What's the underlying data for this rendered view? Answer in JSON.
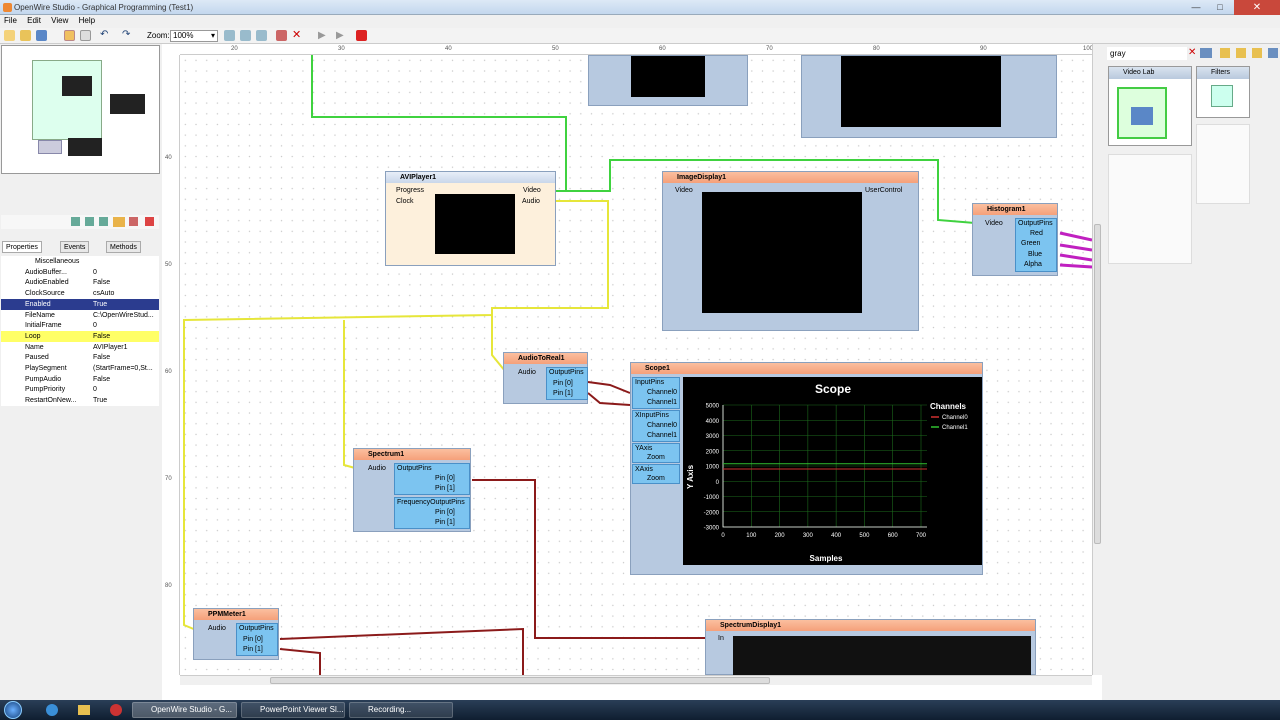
{
  "window": {
    "title": "OpenWire Studio - Graphical Programming (Test1)"
  },
  "menu": [
    "File",
    "Edit",
    "View",
    "Help"
  ],
  "toolbar": {
    "zoom_label": "Zoom:",
    "zoom_value": "100%"
  },
  "ruler": {
    "top": [
      "20",
      "30",
      "40",
      "50",
      "60",
      "70",
      "80",
      "90",
      "100"
    ],
    "left": [
      "40",
      "50",
      "60",
      "70",
      "80"
    ]
  },
  "properties": {
    "tabs": [
      "Properties",
      "Events",
      "Methods"
    ],
    "rows": [
      {
        "name": "Miscellaneous",
        "value": ""
      },
      {
        "name": "AudioBuffer...",
        "value": "0"
      },
      {
        "name": "AudioEnabled",
        "value": "False"
      },
      {
        "name": "ClockSource",
        "value": "csAuto"
      },
      {
        "name": "Enabled",
        "value": "True"
      },
      {
        "name": "FileName",
        "value": "C:\\OpenWireStud..."
      },
      {
        "name": "InitialFrame",
        "value": "0"
      },
      {
        "name": "Loop",
        "value": "False"
      },
      {
        "name": "Name",
        "value": "AVIPlayer1"
      },
      {
        "name": "Paused",
        "value": "False"
      },
      {
        "name": "PlaySegment",
        "value": "(StartFrame=0,St..."
      },
      {
        "name": "PumpAudio",
        "value": "False"
      },
      {
        "name": "PumpPriority",
        "value": "0"
      },
      {
        "name": "RestartOnNew...",
        "value": "True"
      }
    ]
  },
  "components": {
    "avi": {
      "title": "AVIPlayer1",
      "pins": [
        "Progress",
        "Clock",
        "Video",
        "Audio"
      ]
    },
    "imagedisplay": {
      "title": "ImageDisplay1",
      "pins": [
        "Video",
        "UserControl"
      ]
    },
    "histogram": {
      "title": "Histogram1",
      "pins": [
        "Video",
        "OutputPins",
        "Red",
        "Green",
        "Blue",
        "Alpha"
      ]
    },
    "audiotoreal": {
      "title": "AudioToReal1",
      "pins": [
        "Audio",
        "OutputPins",
        "Pin [0]",
        "Pin [1]"
      ]
    },
    "spectrum": {
      "title": "Spectrum1",
      "pins": [
        "Audio",
        "OutputPins",
        "Pin [0]",
        "Pin [1]",
        "FrequencyOutputPins",
        "Pin [0]",
        "Pin [1]"
      ]
    },
    "ppm": {
      "title": "PPMMeter1",
      "pins": [
        "Audio",
        "OutputPins",
        "Pin [0]",
        "Pin [1]"
      ]
    },
    "spectrumdisplay": {
      "title": "SpectrumDisplay1",
      "pins": [
        "In"
      ]
    },
    "scope": {
      "title": "Scope1",
      "pins": [
        "InputPins",
        "Channel0",
        "Channel1",
        "XInputPins",
        "Channel0",
        "Channel1",
        "YAxis",
        "Zoom",
        "XAxis",
        "Zoom"
      ],
      "plot_title": "Scope",
      "ylabel": "Y Axis",
      "xlabel": "Samples",
      "legend_title": "Channels",
      "yticks": [
        "5000",
        "4000",
        "3000",
        "2000",
        "1000",
        "0",
        "-1000",
        "-2000",
        "-3000"
      ],
      "xticks": [
        "0",
        "100",
        "200",
        "300",
        "400",
        "500",
        "600",
        "700"
      ],
      "channels": [
        {
          "name": "Channel0",
          "color": "#d03030"
        },
        {
          "name": "Channel1",
          "color": "#30c030"
        }
      ]
    }
  },
  "rightpanel": {
    "search": "gray",
    "tabs": [
      "Video Lab",
      "Filters"
    ]
  },
  "taskbar": {
    "items": [
      "OpenWire Studio - G...",
      "PowerPoint Viewer Sl...",
      "Recording..."
    ]
  }
}
